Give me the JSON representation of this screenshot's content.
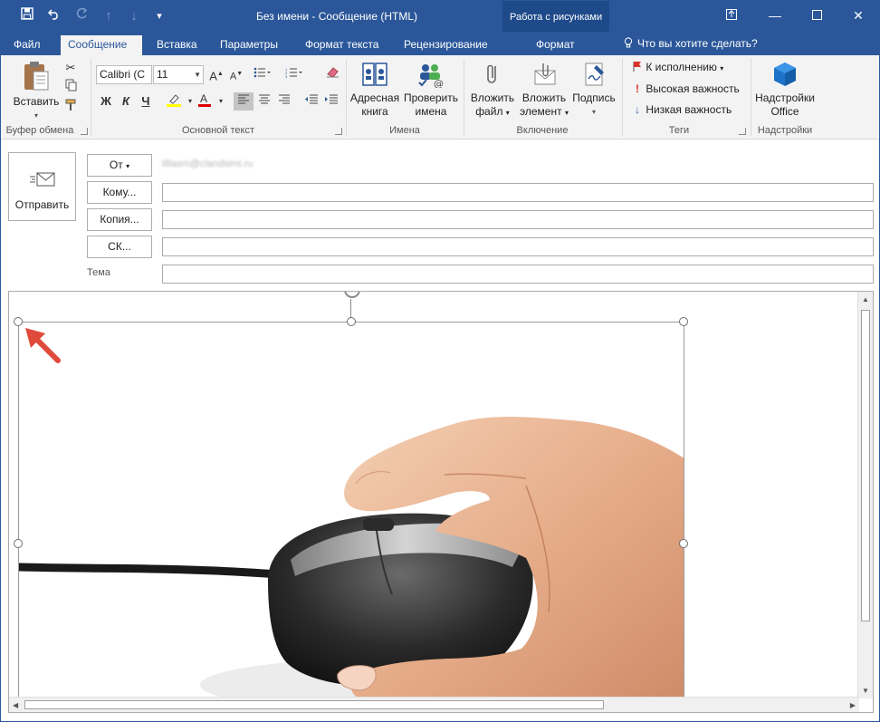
{
  "window": {
    "title": "Без имени - Сообщение (HTML)",
    "context_group": "Работа с рисунками",
    "buttons": [
      "ribbon-display-options-icon",
      "minimize-icon",
      "maximize-icon",
      "close-icon"
    ]
  },
  "quick_access": [
    "save-icon",
    "undo-icon",
    "redo-icon",
    "up-icon",
    "down-icon",
    "customize-icon"
  ],
  "tabs": [
    {
      "label": "Файл",
      "active": false
    },
    {
      "label": "Сообщение",
      "active": true
    },
    {
      "label": "Вставка",
      "active": false
    },
    {
      "label": "Параметры",
      "active": false
    },
    {
      "label": "Формат текста",
      "active": false
    },
    {
      "label": "Рецензирование",
      "active": false
    },
    {
      "label": "Формат",
      "active": false,
      "contextual": true
    }
  ],
  "tell_me": "Что вы хотите сделать?",
  "ribbon": {
    "clipboard": {
      "label": "Буфер обмена",
      "paste": "Вставить"
    },
    "basic_text": {
      "label": "Основной текст",
      "font": "Calibri (С",
      "size": "11",
      "bold": "Ж",
      "italic": "К",
      "underline": "Ч"
    },
    "names": {
      "label": "Имена",
      "address_book": [
        "Адресная",
        "книга"
      ],
      "check_names": [
        "Проверить",
        "имена"
      ]
    },
    "include": {
      "label": "Включение",
      "attach_file": [
        "Вложить",
        "файл"
      ],
      "attach_item": [
        "Вложить",
        "элемент"
      ],
      "signature": "Подпись"
    },
    "tags": {
      "label": "Теги",
      "follow_up": "К исполнению",
      "high": "Высокая важность",
      "low": "Низкая важность"
    },
    "addins": {
      "label": "Надстройки",
      "office": [
        "Надстройки",
        "Office"
      ]
    }
  },
  "header": {
    "send": "Отправить",
    "from": "От",
    "from_address": "lillasm@clandsimi.ru",
    "to": "Кому...",
    "cc": "Копия...",
    "bcc": "СК...",
    "subject_label": "Тема",
    "to_value": "",
    "cc_value": "",
    "bcc_value": "",
    "subject_value": ""
  },
  "colors": {
    "brand": "#2b579a",
    "context_tab": "#1e4a8a",
    "ribbon_bg": "#f3f3f3",
    "arrow": "#e04a3a"
  }
}
